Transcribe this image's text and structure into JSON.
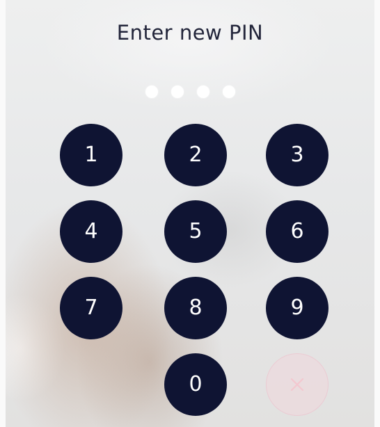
{
  "screen": {
    "title": "Enter new PIN",
    "pin_length": 4,
    "digits_entered": 0
  },
  "keypad": {
    "keys": [
      "1",
      "2",
      "3",
      "4",
      "5",
      "6",
      "7",
      "8",
      "9",
      "0"
    ],
    "delete_icon": "close-icon"
  },
  "colors": {
    "key_background": "#0f1433",
    "key_text": "#ffffff",
    "title_text": "#22253a",
    "dot": "#ffffff",
    "delete_background": "#f0d7dc"
  }
}
